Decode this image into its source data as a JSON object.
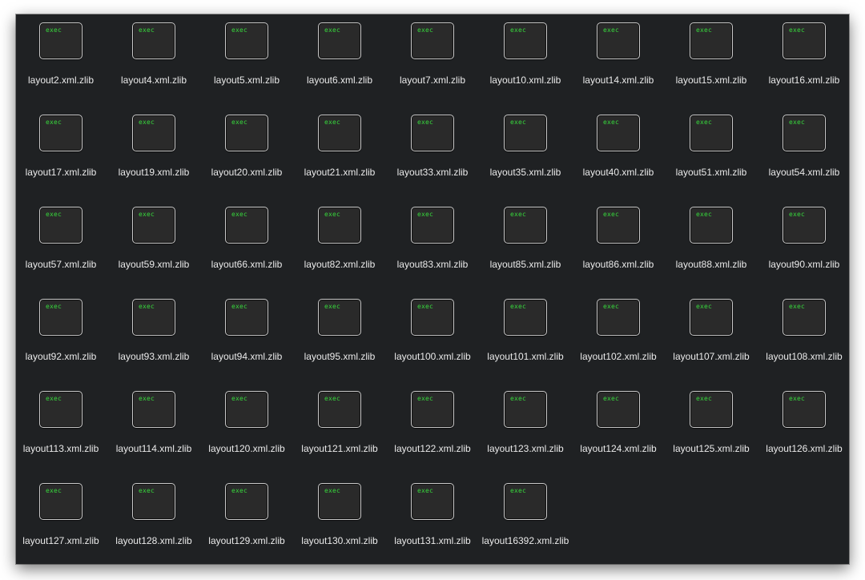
{
  "icon_type": "terminal-exec-icon",
  "icon_text": "exec",
  "colors": {
    "window_bg": "#1f2123",
    "label_text": "#eaeaea",
    "icon_text": "#37d63c"
  },
  "files": [
    "layout2.xml.zlib",
    "layout4.xml.zlib",
    "layout5.xml.zlib",
    "layout6.xml.zlib",
    "layout7.xml.zlib",
    "layout10.xml.zlib",
    "layout14.xml.zlib",
    "layout15.xml.zlib",
    "layout16.xml.zlib",
    "layout17.xml.zlib",
    "layout19.xml.zlib",
    "layout20.xml.zlib",
    "layout21.xml.zlib",
    "layout33.xml.zlib",
    "layout35.xml.zlib",
    "layout40.xml.zlib",
    "layout51.xml.zlib",
    "layout54.xml.zlib",
    "layout57.xml.zlib",
    "layout59.xml.zlib",
    "layout66.xml.zlib",
    "layout82.xml.zlib",
    "layout83.xml.zlib",
    "layout85.xml.zlib",
    "layout86.xml.zlib",
    "layout88.xml.zlib",
    "layout90.xml.zlib",
    "layout92.xml.zlib",
    "layout93.xml.zlib",
    "layout94.xml.zlib",
    "layout95.xml.zlib",
    "layout100.xml.zlib",
    "layout101.xml.zlib",
    "layout102.xml.zlib",
    "layout107.xml.zlib",
    "layout108.xml.zlib",
    "layout113.xml.zlib",
    "layout114.xml.zlib",
    "layout120.xml.zlib",
    "layout121.xml.zlib",
    "layout122.xml.zlib",
    "layout123.xml.zlib",
    "layout124.xml.zlib",
    "layout125.xml.zlib",
    "layout126.xml.zlib",
    "layout127.xml.zlib",
    "layout128.xml.zlib",
    "layout129.xml.zlib",
    "layout130.xml.zlib",
    "layout131.xml.zlib",
    "layout16392.xml.zlib"
  ]
}
